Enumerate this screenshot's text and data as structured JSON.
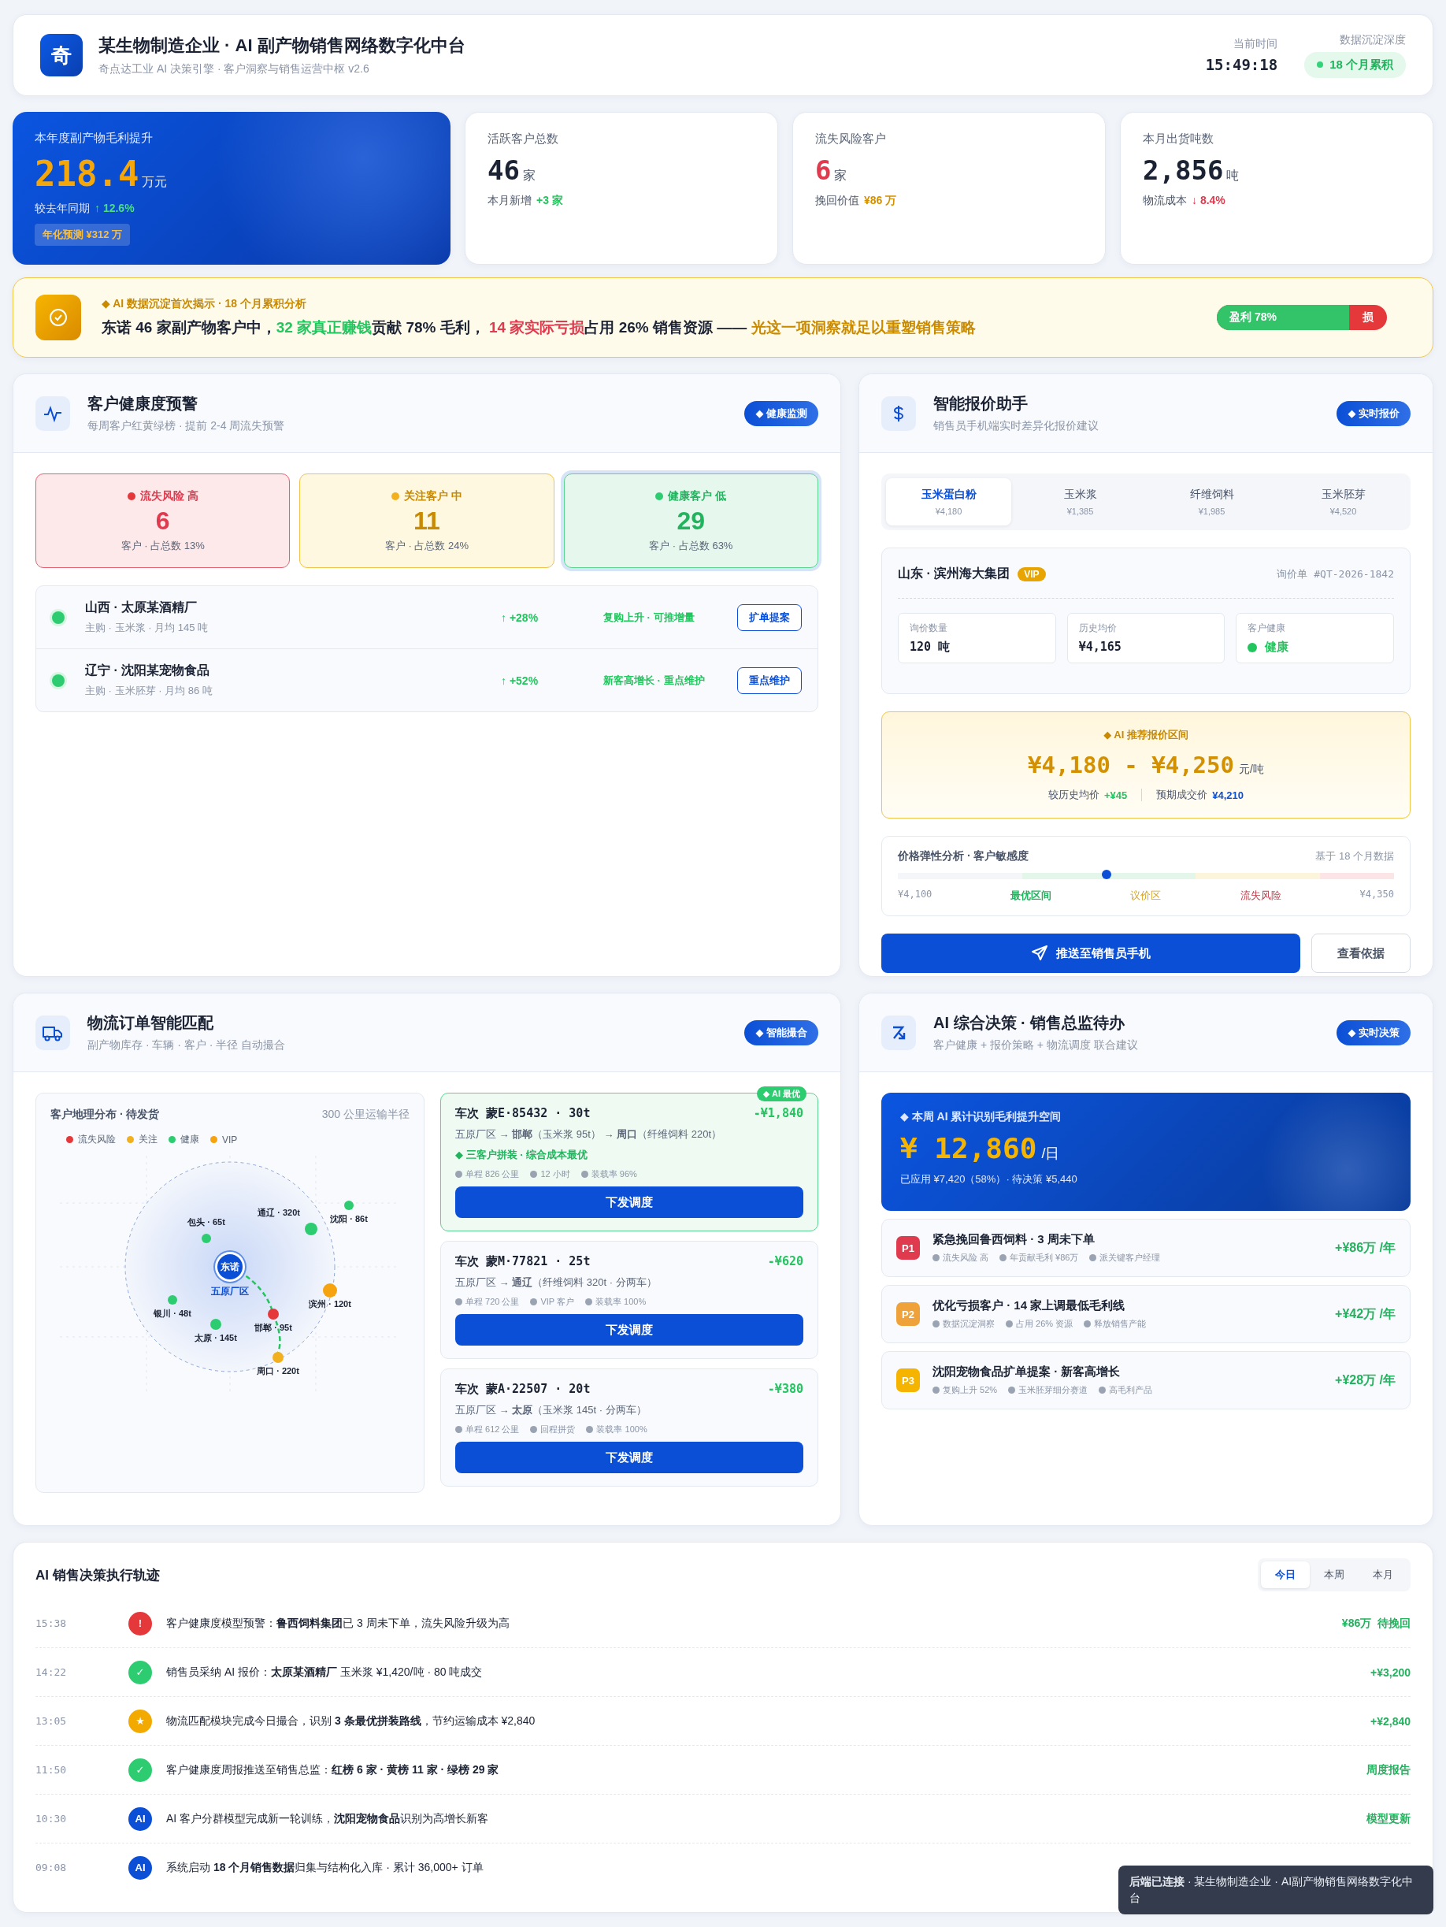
{
  "header": {
    "logo": "奇",
    "title": "某生物制造企业 · AI 副产物销售网络数字化中台",
    "subtitle": "奇点达工业 AI 决策引擎 · 客户洞察与销售运营中枢 v2.6",
    "time_label": "当前时间",
    "time": "15:49:18",
    "depth_label": "数据沉淀深度",
    "depth_badge": "18 个月累积"
  },
  "kpis": [
    {
      "kind": "hero",
      "label": "本年度副产物毛利提升",
      "value": "218.4",
      "unit": "万元",
      "note": "较去年同期",
      "change": {
        "text": "↑ 12.6%",
        "kind": "rise"
      },
      "badge": "年化预测 ¥312 万"
    },
    {
      "kind": "plain",
      "label": "活跃客户总数",
      "value": "46",
      "unit": "家",
      "note": "本月新增",
      "change": {
        "text": "+3 家",
        "kind": "rise"
      }
    },
    {
      "kind": "risk",
      "label": "流失风险客户",
      "value": "6",
      "unit": "家",
      "note": "挽回价值",
      "change": {
        "text": "¥86 万",
        "kind": "money"
      }
    },
    {
      "kind": "plain",
      "label": "本月出货吨数",
      "value": "2,856",
      "unit": "吨",
      "note": "物流成本",
      "change": {
        "text": "↓ 8.4%",
        "kind": "fall"
      }
    }
  ],
  "insight": {
    "kicker": "◆ AI 数据沉淀首次揭示 · 18 个月累积分析",
    "segments": [
      {
        "text": "东诺 46 家副产物客户中，"
      },
      {
        "text": "32 家真正赚钱",
        "color": "#22c55e"
      },
      {
        "text": "贡献 78% 毛利， "
      },
      {
        "text": "14 家实际亏损",
        "color": "#e03a4e"
      },
      {
        "text": "占用 26% 销售资源 —— "
      },
      {
        "text": "光这一项洞察就足以重塑销售策略",
        "color": "#c98a00"
      }
    ],
    "profit_bar": {
      "profit_label": "盈利 78%",
      "level": 0.78,
      "loss_label": "损"
    }
  },
  "health": {
    "title": "客户健康度预警",
    "subtitle": "每周客户红黄绿榜 · 提前 2-4 周流失预警",
    "tag": "◆ 健康监测",
    "tiers": [
      {
        "kind": "risk",
        "label": "流失风险 高",
        "count": "6",
        "note": "客户 · 占总数 13%",
        "selected": false
      },
      {
        "kind": "watch",
        "label": "关注客户 中",
        "count": "11",
        "note": "客户 · 占总数 24%",
        "selected": false
      },
      {
        "kind": "healthy",
        "label": "健康客户 低",
        "count": "29",
        "note": "客户 · 占总数 63%",
        "selected": true
      }
    ],
    "customers": [
      {
        "name": "山西 · 太原某酒精厂",
        "detail": "主购 · 玉米浆 · 月均 145 吨",
        "color": "#2ecc71",
        "change": "↑ +28%",
        "insight": "复购上升 · 可推增量",
        "action": "扩单提案"
      },
      {
        "name": "辽宁 · 沈阳某宠物食品",
        "detail": "主购 · 玉米胚芽 · 月均 86 吨",
        "color": "#2ecc71",
        "change": "↑ +52%",
        "insight": "新客高增长 · 重点维护",
        "action": "重点维护"
      }
    ]
  },
  "quote": {
    "title": "智能报价助手",
    "subtitle": "销售员手机端实时差异化报价建议",
    "tag": "◆ 实时报价",
    "products": [
      {
        "name": "玉米蛋白粉",
        "price": "¥4,180",
        "selected": true
      },
      {
        "name": "玉米浆",
        "price": "¥1,385",
        "selected": false
      },
      {
        "name": "纤维饲料",
        "price": "¥1,985",
        "selected": false
      },
      {
        "name": "玉米胚芽",
        "price": "¥4,520",
        "selected": false
      }
    ],
    "customer": {
      "name": "山东 · 滨州海大集团",
      "badge": "VIP",
      "ref": "询价单 #QT-2026-1842",
      "fields": [
        {
          "label": "询价数量",
          "value": "120 吨"
        },
        {
          "label": "历史均价",
          "value": "¥4,165"
        },
        {
          "label": "客户健康",
          "value": "健康",
          "color": "#22c55e"
        }
      ]
    },
    "recommendation": {
      "kicker": "◆ AI 推荐报价区间",
      "range": "¥4,180 - ¥4,250",
      "unit": "元/吨",
      "compare_label": "较历史均价",
      "compare_value": "+¥45",
      "expect_label": "预期成交价",
      "expect_value": "¥4,210"
    },
    "elasticity": {
      "title": "价格弹性分析 · 客户敏感度",
      "basis": "基于 18 个月数据",
      "min": "¥4,100",
      "max": "¥4,350",
      "level": 0.42,
      "zones": [
        {
          "label": "最优区间",
          "kind": "optimal"
        },
        {
          "label": "议价区",
          "kind": "negotiate"
        },
        {
          "label": "流失风险",
          "kind": "risk"
        }
      ]
    },
    "primary_action": "推送至销售员手机",
    "secondary_action": "查看依据"
  },
  "logistics": {
    "title": "物流订单智能匹配",
    "subtitle": "副产物库存 · 车辆 · 客户 · 半径 自动撮合",
    "tag": "◆ 智能撮合",
    "map": {
      "title": "客户地理分布 · 待发货",
      "radius": "300 公里运输半径",
      "legend": [
        {
          "label": "流失风险",
          "color": "#e5383b"
        },
        {
          "label": "关注",
          "color": "#f2b01e"
        },
        {
          "label": "健康",
          "color": "#2ecc71"
        },
        {
          "label": "VIP",
          "color": "#f5a30f"
        }
      ],
      "hub": {
        "label": "东诺",
        "name": "五原厂区"
      },
      "nodes": [
        {
          "label": "包头 · 65t",
          "kind": "healthy"
        },
        {
          "label": "通辽 · 320t",
          "kind": "healthy"
        },
        {
          "label": "沈阳 · 86t",
          "kind": "healthy"
        },
        {
          "label": "滨州 · 120t",
          "kind": "vip"
        },
        {
          "label": "银川 · 48t",
          "kind": "healthy"
        },
        {
          "label": "太原 · 145t",
          "kind": "healthy"
        },
        {
          "label": "邯郸 · 95t",
          "kind": "risk"
        },
        {
          "label": "周口 · 220t",
          "kind": "watch"
        }
      ]
    },
    "orders": [
      {
        "vehicle": "车次 蒙E·85432 · 30t",
        "saving": "-¥1,840",
        "recommended": true,
        "badge": "◆ AI 最优",
        "route": "五原厂区 → **邯郸**（玉米浆 95t） → **周口**（纤维饲料 220t）",
        "note": "◆ 三客户拼装 · 综合成本最优",
        "metrics": [
          "单程 826 公里",
          "12 小时",
          "装载率 96%"
        ],
        "action": "下发调度"
      },
      {
        "vehicle": "车次 蒙M·77821 · 25t",
        "saving": "-¥620",
        "recommended": false,
        "route": "五原厂区 → **通辽**（纤维饲料 320t · 分两车）",
        "metrics": [
          "单程 720 公里",
          "VIP 客户",
          "装载率 100%"
        ],
        "action": "下发调度"
      },
      {
        "vehicle": "车次 蒙A·22507 · 20t",
        "saving": "-¥380",
        "recommended": false,
        "route": "五原厂区 → **太原**（玉米浆 145t · 分两车）",
        "metrics": [
          "单程 612 公里",
          "回程拼货",
          "装载率 100%"
        ],
        "action": "下发调度"
      }
    ]
  },
  "decisions": {
    "title": "AI 综合决策 · 销售总监待办",
    "subtitle": "客户健康 + 报价策略 + 物流调度 联合建议",
    "tag": "◆ 实时决策",
    "summary": {
      "kicker": "◆ 本周 AI 累计识别毛利提升空间",
      "value": "¥ 12,860",
      "unit": "/日",
      "note": "已应用 ¥7,420（58%）· 待决策 ¥5,440"
    },
    "tasks": [
      {
        "priority": "P1",
        "color": "#e03a4e",
        "title": "紧急挽回鲁西饲料 · 3 周未下单",
        "tags": [
          "流失风险 高",
          "年贡献毛利 ¥86万",
          "派关键客户经理"
        ],
        "gain": "+¥86万 /年"
      },
      {
        "priority": "P2",
        "color": "#f0a23a",
        "title": "优化亏损客户 · 14 家上调最低毛利线",
        "tags": [
          "数据沉淀洞察",
          "占用 26% 资源",
          "释放销售产能"
        ],
        "gain": "+¥42万 /年"
      },
      {
        "priority": "P3",
        "color": "#f5b400",
        "title": "沈阳宠物食品扩单提案 · 新客高增长",
        "tags": [
          "复购上升 52%",
          "玉米胚芽细分赛道",
          "高毛利产品"
        ],
        "gain": "+¥28万 /年"
      }
    ]
  },
  "timeline": {
    "title": "AI 销售决策执行轨迹",
    "ranges": [
      {
        "label": "今日",
        "selected": true
      },
      {
        "label": "本周",
        "selected": false
      },
      {
        "label": "本月",
        "selected": false
      }
    ],
    "events": [
      {
        "time": "15:38",
        "kind": "alert",
        "glyph": "!",
        "text": "客户健康度模型预警：**鲁西饲料集团**已 3 周未下单，流失风险升级为高",
        "result": "¥86万  待挽回"
      },
      {
        "time": "14:22",
        "kind": "done",
        "glyph": "✓",
        "text": "销售员采纳 AI 报价：**太原某酒精厂** 玉米浆 ¥1,420/吨 · 80 吨成交",
        "result": "+¥3,200"
      },
      {
        "time": "13:05",
        "kind": "star",
        "glyph": "★",
        "text": "物流匹配模块完成今日撮合，识别 **3 条最优拼装路线**，节约运输成本 ¥2,840",
        "result": "+¥2,840"
      },
      {
        "time": "11:50",
        "kind": "done",
        "glyph": "✓",
        "text": "客户健康度周报推送至销售总监：**红榜 6 家 · 黄榜 11 家 · 绿榜 29 家**",
        "result": "周度报告"
      },
      {
        "time": "10:30",
        "kind": "ai",
        "glyph": "AI",
        "text": "AI 客户分群模型完成新一轮训练，**沈阳宠物食品**识别为高增长新客",
        "result": "模型更新"
      },
      {
        "time": "09:08",
        "kind": "ai",
        "glyph": "AI",
        "text": "系统启动 **18 个月销售数据**归集与结构化入库 · 累计 36,000+ 订单"
      }
    ]
  },
  "toast": {
    "text": "**后端已连接** · 某生物制造企业 · AI副产物销售网络数字化中台"
  }
}
